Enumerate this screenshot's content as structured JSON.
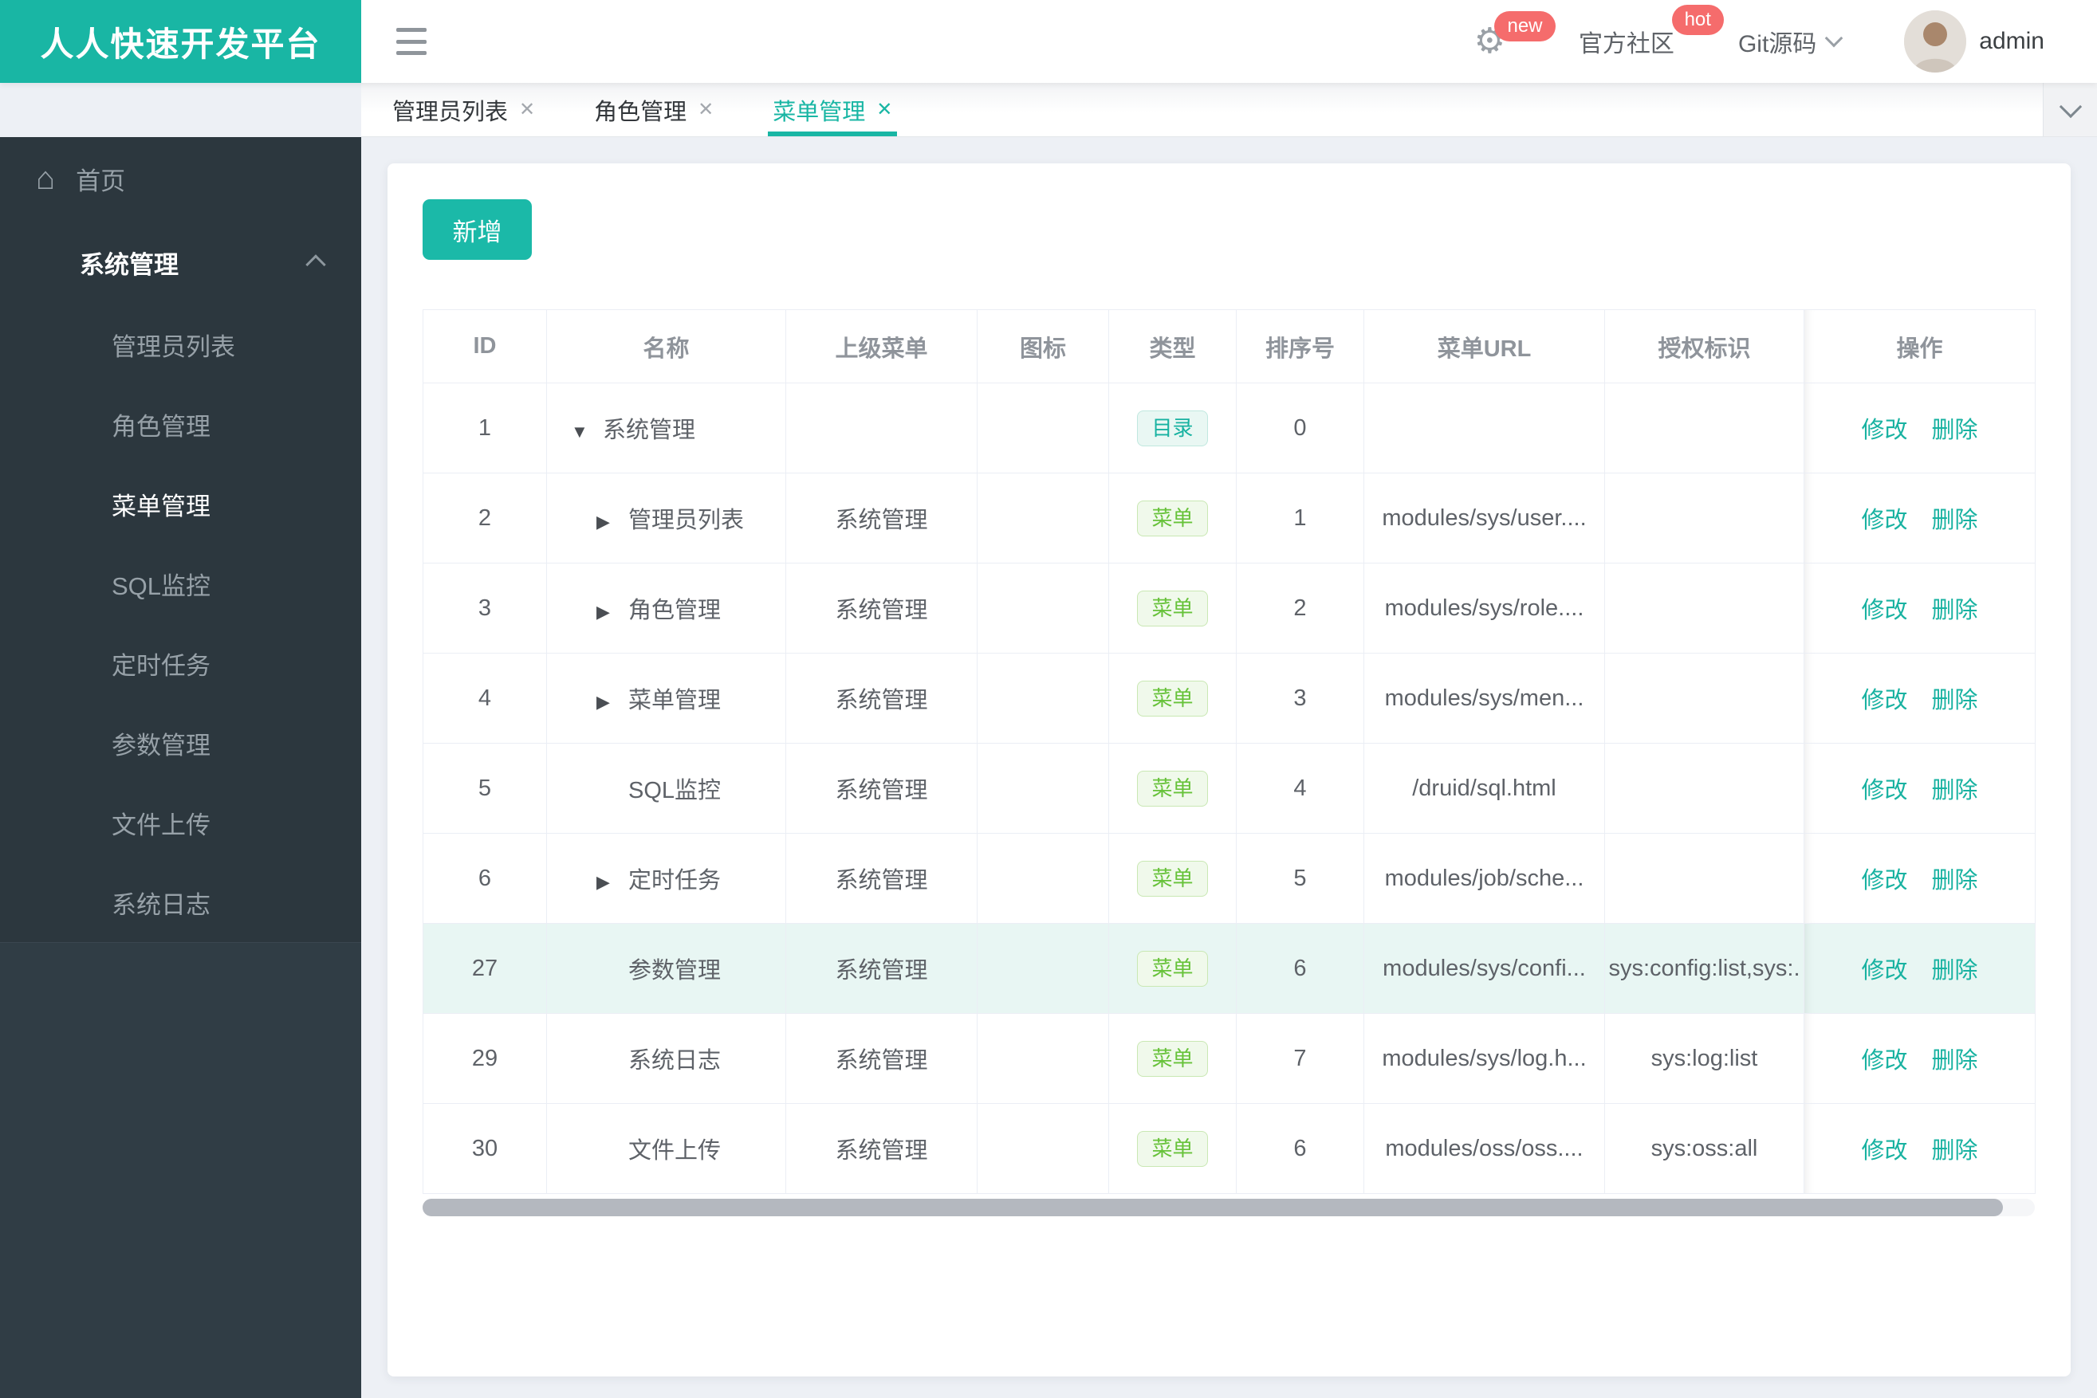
{
  "brand": {
    "title": "人人快速开发平台"
  },
  "header": {
    "community_label": "官方社区",
    "git_label": "Git源码",
    "username": "admin",
    "badge_new": "new",
    "badge_hot": "hot"
  },
  "tabs": [
    {
      "label": "管理员列表",
      "active": false
    },
    {
      "label": "角色管理",
      "active": false
    },
    {
      "label": "菜单管理",
      "active": true
    }
  ],
  "sidebar": {
    "home_label": "首页",
    "group_label": "系统管理",
    "items": [
      {
        "label": "管理员列表",
        "active": false
      },
      {
        "label": "角色管理",
        "active": false
      },
      {
        "label": "菜单管理",
        "active": true
      },
      {
        "label": "SQL监控",
        "active": false
      },
      {
        "label": "定时任务",
        "active": false
      },
      {
        "label": "参数管理",
        "active": false
      },
      {
        "label": "文件上传",
        "active": false
      },
      {
        "label": "系统日志",
        "active": false
      }
    ]
  },
  "toolbar": {
    "add_label": "新增"
  },
  "icons": {
    "home": "⌂",
    "gear": "⚙",
    "expand_down": "▼",
    "expand_right": "▶",
    "close": "✕"
  },
  "table": {
    "columns": [
      "ID",
      "名称",
      "上级菜单",
      "图标",
      "类型",
      "排序号",
      "菜单URL",
      "授权标识",
      "操作"
    ],
    "type_labels": {
      "dir": "目录",
      "menu": "菜单"
    },
    "actions": {
      "edit": "修改",
      "delete": "删除"
    },
    "rows": [
      {
        "id": "1",
        "name": "系统管理",
        "level": 0,
        "expand": "down",
        "parent": "",
        "type": "dir",
        "order": "0",
        "url": "",
        "perms": "",
        "highlight": false
      },
      {
        "id": "2",
        "name": "管理员列表",
        "level": 1,
        "expand": "right",
        "parent": "系统管理",
        "type": "menu",
        "order": "1",
        "url": "modules/sys/user....",
        "perms": "",
        "highlight": false
      },
      {
        "id": "3",
        "name": "角色管理",
        "level": 1,
        "expand": "right",
        "parent": "系统管理",
        "type": "menu",
        "order": "2",
        "url": "modules/sys/role....",
        "perms": "",
        "highlight": false
      },
      {
        "id": "4",
        "name": "菜单管理",
        "level": 1,
        "expand": "right",
        "parent": "系统管理",
        "type": "menu",
        "order": "3",
        "url": "modules/sys/men...",
        "perms": "",
        "highlight": false
      },
      {
        "id": "5",
        "name": "SQL监控",
        "level": 1,
        "expand": "none",
        "parent": "系统管理",
        "type": "menu",
        "order": "4",
        "url": "/druid/sql.html",
        "perms": "",
        "highlight": false
      },
      {
        "id": "6",
        "name": "定时任务",
        "level": 1,
        "expand": "right",
        "parent": "系统管理",
        "type": "menu",
        "order": "5",
        "url": "modules/job/sche...",
        "perms": "",
        "highlight": false
      },
      {
        "id": "27",
        "name": "参数管理",
        "level": 1,
        "expand": "none",
        "parent": "系统管理",
        "type": "menu",
        "order": "6",
        "url": "modules/sys/confi...",
        "perms": "sys:config:list,sys:.",
        "highlight": true
      },
      {
        "id": "29",
        "name": "系统日志",
        "level": 1,
        "expand": "none",
        "parent": "系统管理",
        "type": "menu",
        "order": "7",
        "url": "modules/sys/log.h...",
        "perms": "sys:log:list",
        "highlight": false
      },
      {
        "id": "30",
        "name": "文件上传",
        "level": 1,
        "expand": "none",
        "parent": "系统管理",
        "type": "menu",
        "order": "6",
        "url": "modules/oss/oss....",
        "perms": "sys:oss:all",
        "highlight": false
      }
    ]
  },
  "colors": {
    "accent": "#19b6a4",
    "badge_red": "#f56c6c",
    "sidebar_bg": "#2c373e",
    "tag_dir_text": "#18b2a1",
    "tag_menu_text": "#67c23a",
    "row_highlight": "#e8f6f3"
  }
}
